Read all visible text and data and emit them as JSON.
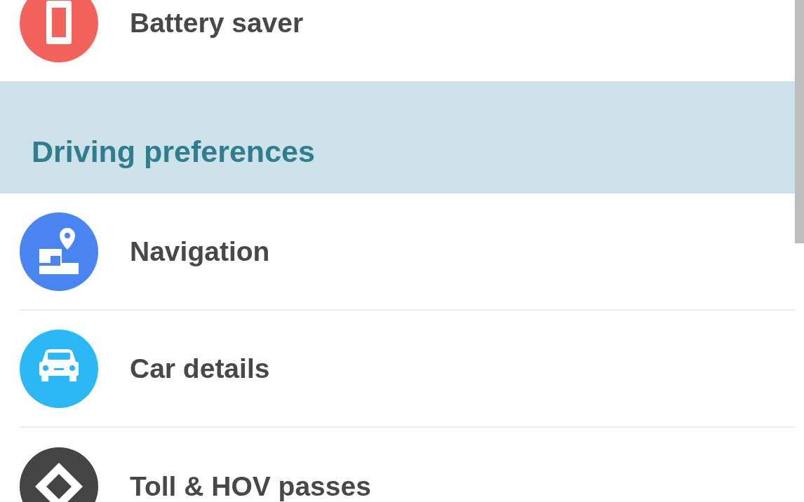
{
  "entries": [
    {
      "kind": "battery",
      "color": "#f4625c",
      "label": "Battery saver"
    },
    {
      "kind": "section_header",
      "label": "Driving preferences"
    },
    {
      "kind": "navigation",
      "color": "#4a84f0",
      "label": "Navigation"
    },
    {
      "kind": "car",
      "color": "#2bb8f5",
      "label": "Car details"
    },
    {
      "kind": "toll",
      "color": "#444444",
      "label": "Toll & HOV passes"
    }
  ]
}
